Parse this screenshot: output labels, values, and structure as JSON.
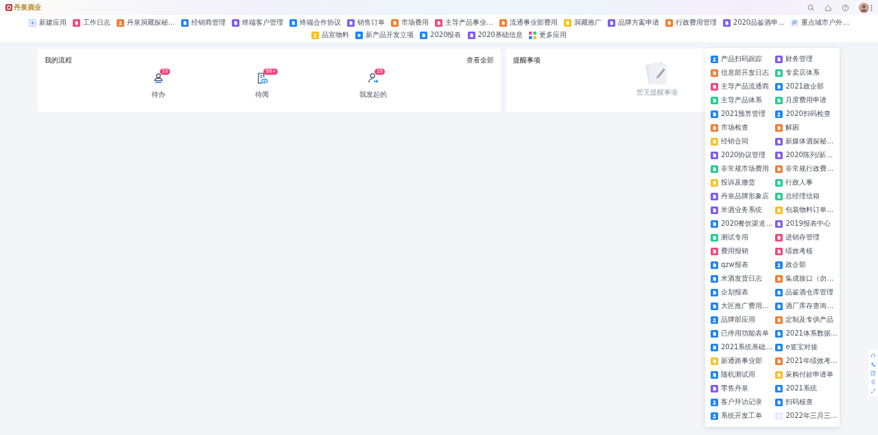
{
  "header": {
    "logo": "丹泉酒业"
  },
  "app_bar": {
    "items": [
      {
        "label": "新建应用",
        "kind": "add",
        "color": "#e3edff"
      },
      {
        "label": "工作日志",
        "kind": "doc",
        "color": "#f5457a"
      },
      {
        "label": "丹泉洞藏探秘…",
        "kind": "person",
        "color": "#f97a2a"
      },
      {
        "label": "经销商管理",
        "kind": "doc",
        "color": "#1a84ff"
      },
      {
        "label": "终端客户管理",
        "kind": "doc",
        "color": "#7b5cf5"
      },
      {
        "label": "终端合作协议",
        "kind": "doc",
        "color": "#1a84ff"
      },
      {
        "label": "销售订单",
        "kind": "doc",
        "color": "#7b5cf5"
      },
      {
        "label": "市场费用",
        "kind": "doc",
        "color": "#f97a2a"
      },
      {
        "label": "主导产品事业…",
        "kind": "doc",
        "color": "#f5457a"
      },
      {
        "label": "流通事业部费用",
        "kind": "doc",
        "color": "#f97a2a"
      },
      {
        "label": "洞藏推广",
        "kind": "doc",
        "color": "#fcbf1e"
      },
      {
        "label": "品牌方案申请",
        "kind": "doc",
        "color": "#7b5cf5"
      },
      {
        "label": "行政费用管理",
        "kind": "doc",
        "color": "#f97a2a"
      },
      {
        "label": "2020品鉴酒申…",
        "kind": "doc",
        "color": "#7b5cf5"
      },
      {
        "label": "重点城市户外…",
        "kind": "flag",
        "color": "#e3edff"
      },
      {
        "label": "品宣物料",
        "kind": "person",
        "color": "#fcbf1e"
      },
      {
        "label": "新产品开发立项",
        "kind": "star",
        "color": "#1a84ff"
      },
      {
        "label": "2020报表",
        "kind": "doc",
        "color": "#1a84ff"
      },
      {
        "label": "2020基础信息",
        "kind": "doc",
        "color": "#7b5cf5"
      },
      {
        "label": "更多应用",
        "kind": "more"
      }
    ]
  },
  "flow_card": {
    "title": "我的流程",
    "more_link": "查看全部",
    "items": [
      {
        "label": "待办",
        "badge": "33",
        "kind": "todo"
      },
      {
        "label": "待阅",
        "badge": "99+",
        "kind": "read"
      },
      {
        "label": "我发起的",
        "badge": "15",
        "kind": "started"
      }
    ]
  },
  "reminder_card": {
    "title": "提醒事项",
    "empty_text": "暂无提醒事项"
  },
  "more_apps": {
    "items": [
      {
        "label": "产品扫码跟踪",
        "kind": "person",
        "color": "#1a84ff"
      },
      {
        "label": "财务管理",
        "kind": "doc",
        "color": "#7b5cf5"
      },
      {
        "label": "信息部开发日志",
        "kind": "doc",
        "color": "#f97a2a"
      },
      {
        "label": "专卖店体系",
        "kind": "doc",
        "color": "#1fcf8f"
      },
      {
        "label": "主导产品流通商",
        "kind": "doc",
        "color": "#f5457a"
      },
      {
        "label": "2021政企部",
        "kind": "doc",
        "color": "#1a84ff"
      },
      {
        "label": "主导产品体系",
        "kind": "doc",
        "color": "#1fcf8f"
      },
      {
        "label": "月度费用申请",
        "kind": "doc",
        "color": "#1fcf8f"
      },
      {
        "label": "2021预算管理",
        "kind": "doc",
        "color": "#1a84ff"
      },
      {
        "label": "2020扫码检查",
        "kind": "person",
        "color": "#1a84ff"
      },
      {
        "label": "市场检查",
        "kind": "doc",
        "color": "#f97a2a"
      },
      {
        "label": "解困",
        "kind": "doc",
        "color": "#f97a2a"
      },
      {
        "label": "经销合同",
        "kind": "doc",
        "color": "#fcbf1e"
      },
      {
        "label": "新媒体酒探秘…",
        "kind": "doc",
        "color": "#7b5cf5"
      },
      {
        "label": "2020协议管理",
        "kind": "doc",
        "color": "#7b5cf5"
      },
      {
        "label": "2020陈列/新…",
        "kind": "doc",
        "color": "#7b5cf5"
      },
      {
        "label": "非常规市场费用",
        "kind": "doc",
        "color": "#1fcf8f"
      },
      {
        "label": "非常规行政费…",
        "kind": "doc",
        "color": "#f97a2a"
      },
      {
        "label": "投诉及撤货",
        "kind": "doc",
        "color": "#fcbf1e"
      },
      {
        "label": "行政人事",
        "kind": "doc",
        "color": "#1fcf8f"
      },
      {
        "label": "丹泉品牌形象店",
        "kind": "doc",
        "color": "#7b5cf5"
      },
      {
        "label": "总经理信箱",
        "kind": "doc",
        "color": "#1fcf8f"
      },
      {
        "label": "米酒业务系统",
        "kind": "doc",
        "color": "#7b5cf5"
      },
      {
        "label": "包装物料订单…",
        "kind": "doc",
        "color": "#fcbf1e"
      },
      {
        "label": "2020餐饮渠道…",
        "kind": "doc",
        "color": "#1a84ff"
      },
      {
        "label": "2019报表中心",
        "kind": "doc",
        "color": "#7b5cf5"
      },
      {
        "label": "测试专用",
        "kind": "doc",
        "color": "#1fcf8f"
      },
      {
        "label": "进销存管理",
        "kind": "doc",
        "color": "#f5457a"
      },
      {
        "label": "费用报销",
        "kind": "doc",
        "color": "#f5457a"
      },
      {
        "label": "绩效考核",
        "kind": "doc",
        "color": "#f5457a"
      },
      {
        "label": "qzw报表",
        "kind": "doc",
        "color": "#1a84ff"
      },
      {
        "label": "政企部",
        "kind": "person",
        "color": "#1a84ff"
      },
      {
        "label": "米酒发货日志",
        "kind": "doc",
        "color": "#1a84ff"
      },
      {
        "label": "集成接口（勿…",
        "kind": "doc",
        "color": "#f97a2a"
      },
      {
        "label": "企划报表",
        "kind": "doc",
        "color": "#1a84ff"
      },
      {
        "label": "品鉴酒仓库管理",
        "kind": "doc",
        "color": "#1a84ff"
      },
      {
        "label": "大区推广费用…",
        "kind": "doc",
        "color": "#1a84ff"
      },
      {
        "label": "酒厂库存查询…",
        "kind": "doc",
        "color": "#1a84ff"
      },
      {
        "label": "品牌部应用",
        "kind": "person",
        "color": "#1a84ff"
      },
      {
        "label": "定制及专供产品",
        "kind": "doc",
        "color": "#f97a2a"
      },
      {
        "label": "已停用功能表单",
        "kind": "doc",
        "color": "#1a84ff"
      },
      {
        "label": "2021体系数据…",
        "kind": "doc",
        "color": "#1a84ff"
      },
      {
        "label": "2021系统基础…",
        "kind": "doc",
        "color": "#1a84ff"
      },
      {
        "label": "e签宝对接",
        "kind": "doc",
        "color": "#1a84ff"
      },
      {
        "label": "新通路事业部",
        "kind": "doc",
        "color": "#fcbf1e"
      },
      {
        "label": "2021年绩效考…",
        "kind": "doc",
        "color": "#f97a2a"
      },
      {
        "label": "随机测试用",
        "kind": "doc",
        "color": "#1a84ff"
      },
      {
        "label": "采购付款申请单",
        "kind": "doc",
        "color": "#fcbf1e"
      },
      {
        "label": "零售丹泉",
        "kind": "doc",
        "color": "#7b5cf5"
      },
      {
        "label": "2021系统",
        "kind": "doc",
        "color": "#1a84ff"
      },
      {
        "label": "客户拜访记录",
        "kind": "person",
        "color": "#1a84ff"
      },
      {
        "label": "扫码核查",
        "kind": "doc",
        "color": "#1a84ff"
      },
      {
        "label": "系统开发工单",
        "kind": "person",
        "color": "#1a84ff"
      },
      {
        "label": "2022年三月三…",
        "kind": "doc",
        "color": "#e3edff"
      }
    ]
  }
}
